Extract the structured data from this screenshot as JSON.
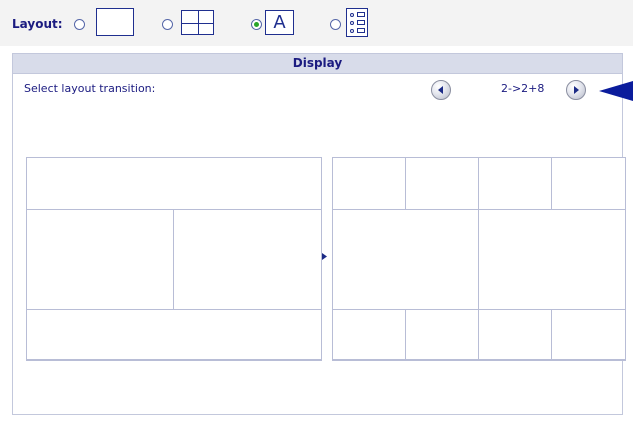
{
  "layout_bar": {
    "label": "Layout:",
    "options": [
      {
        "name": "single",
        "selected": false
      },
      {
        "name": "grid-2x2",
        "selected": false
      },
      {
        "name": "text-a",
        "selected": true,
        "letter": "A"
      },
      {
        "name": "list",
        "selected": false
      }
    ]
  },
  "display": {
    "title": "Display",
    "transition_label": "Select layout transition:",
    "transition_value": "2->2+8",
    "prev_icon": "arrow-left-icon",
    "next_icon": "arrow-right-icon"
  },
  "preview": {
    "from_layout": "2",
    "to_layout": "2+8"
  },
  "colors": {
    "accent": "#1b1b80",
    "panel_header": "#d8dcea",
    "cell_border": "#b8bdd6",
    "selected_radio": "#2aa52a",
    "pointer": "#0b1c9c"
  }
}
